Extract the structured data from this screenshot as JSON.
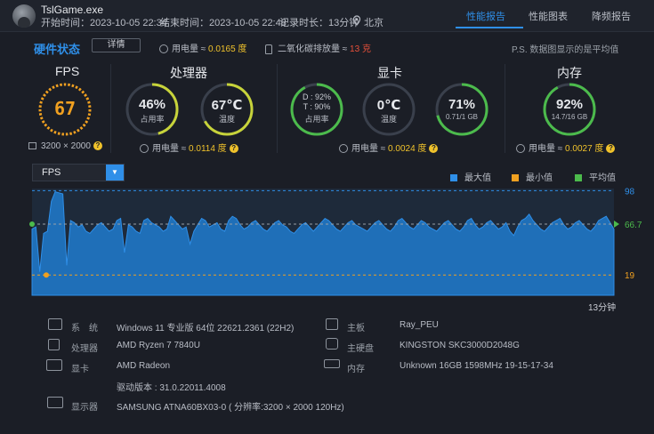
{
  "header": {
    "app_name": "TslGame.exe",
    "start_time": "开始时间：2023-10-05 22:34",
    "end_time": "结束时间：2023-10-05 22:48",
    "duration": "记录时长：13分钟",
    "location": "北京",
    "tabs": [
      "性能报告",
      "性能图表",
      "降频报告"
    ],
    "active_tab": 0
  },
  "status": {
    "title": "硬件状态",
    "detail_button": "详情",
    "power_label": "用电量 ≈ ",
    "power_value": "0.0165 度",
    "co2_label": "二氧化碳排放量 ≈ ",
    "co2_value": "13 克",
    "note": "P.S. 数据图显示的是平均值"
  },
  "fps": {
    "title": "FPS",
    "value": "67",
    "resolution": "3200 × 2000"
  },
  "cpu": {
    "title": "处理器",
    "usage_value": "46%",
    "usage_label": "占用率",
    "usage_fraction": 0.46,
    "temp_value": "67℃",
    "temp_label": "温度",
    "temp_fraction": 0.67,
    "power_label": "用电量 ≈ ",
    "power_value": "0.0114 度"
  },
  "gpu": {
    "title": "显卡",
    "d_value": "D : 92%",
    "t_value": "T : 90%",
    "usage_label": "占用率",
    "d_fraction": 0.92,
    "t_fraction": 0.9,
    "temp_value": "0℃",
    "temp_label": "温度",
    "temp_fraction": 0.0,
    "mem_value": "71%",
    "mem_label": "0.71/1 GB",
    "mem_fraction": 0.71,
    "power_label": "用电量 ≈ ",
    "power_value": "0.0024 度"
  },
  "memory": {
    "title": "内存",
    "usage_value": "92%",
    "usage_label": "14.7/16 GB",
    "usage_fraction": 0.92,
    "power_label": "用电量 ≈ ",
    "power_value": "0.0027 度"
  },
  "chart_controls": {
    "metric_select": "FPS",
    "legend": [
      "最大值",
      "最小值",
      "平均值"
    ],
    "legend_colors": [
      "#2f8fe8",
      "#f0a020",
      "#4cbb4c"
    ]
  },
  "chart_data": {
    "type": "area",
    "title": "",
    "xlabel": "",
    "ylabel": "",
    "x_end_label": "13分钟",
    "max_label": "98",
    "avg_label": "66.7",
    "min_label": "19",
    "max": 98,
    "avg": 66.7,
    "min": 19,
    "ylim": [
      0,
      100
    ],
    "series": [
      {
        "values": [
          62,
          64,
          22,
          58,
          60,
          88,
          97,
          96,
          95,
          28,
          70,
          68,
          64,
          66,
          60,
          58,
          62,
          66,
          68,
          64,
          60,
          62,
          70,
          72,
          40,
          66,
          64,
          60,
          58,
          70,
          72,
          68,
          66,
          64,
          60,
          62,
          74,
          70,
          66,
          62,
          64,
          48,
          60,
          66,
          72,
          70,
          64,
          66,
          68,
          62,
          60,
          70,
          74,
          72,
          66,
          62,
          64,
          68,
          70,
          66,
          62,
          60,
          64,
          68,
          70,
          66,
          64,
          60,
          58,
          62,
          66,
          68,
          64,
          60,
          64,
          68,
          72,
          70,
          66,
          62,
          60,
          64,
          68,
          70,
          66,
          64,
          62,
          60,
          64,
          68,
          70,
          66,
          62,
          60,
          64,
          70,
          72,
          68,
          64,
          62,
          66,
          70,
          68,
          64,
          62,
          60,
          64,
          68,
          70,
          66,
          62,
          60,
          64,
          70,
          72,
          66,
          62,
          64,
          68,
          70,
          66,
          62,
          64,
          68,
          60,
          56,
          64,
          70,
          72,
          76,
          70,
          66,
          62,
          60,
          64,
          68,
          70,
          72,
          66,
          62,
          64,
          68,
          70,
          66,
          62,
          60,
          64,
          70,
          72,
          74,
          68,
          62
        ]
      }
    ]
  },
  "system_info": {
    "os_label": "系　统",
    "os_value": "Windows 11 专业版 64位 22621.2361 (22H2)",
    "cpu_label": "处理器",
    "cpu_value": "AMD Ryzen 7 7840U",
    "gpu_label": "显卡",
    "gpu_value": "AMD Radeon",
    "driver_value": "驱动版本 : 31.0.22011.4008",
    "display_label": "显示器",
    "display_value": "SAMSUNG ATNA60BX03-0 ( 分辨率:3200 × 2000 120Hz)",
    "board_label": "主板",
    "board_value": "Ray_PEU",
    "disk_label": "主硬盘",
    "disk_value": "KINGSTON SKC3000D2048G",
    "mem_label": "内存",
    "mem_value": "Unknown 16GB 1598MHz 19-15-17-34"
  }
}
